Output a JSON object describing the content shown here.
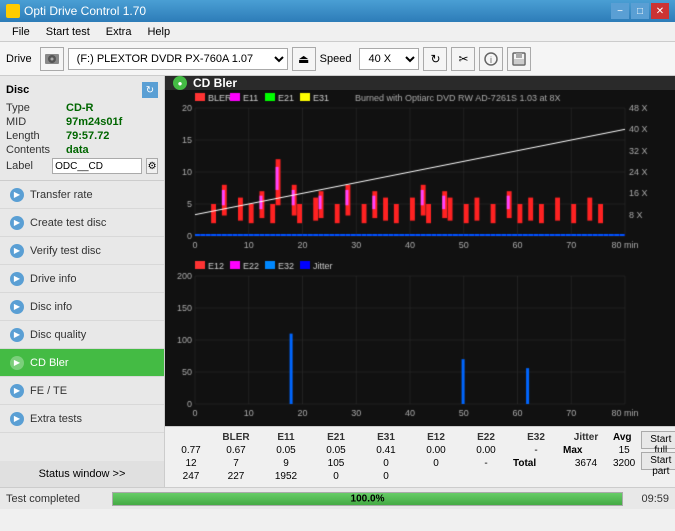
{
  "titleBar": {
    "title": "Opti Drive Control 1.70",
    "iconColor": "#ffcc00"
  },
  "menuBar": {
    "items": [
      "File",
      "Start test",
      "Extra",
      "Help"
    ]
  },
  "toolbar": {
    "driveLabel": "Drive",
    "driveValue": "(F:)  PLEXTOR DVDR  PX-760A 1.07",
    "speedLabel": "Speed",
    "speedValue": "40 X"
  },
  "discPanel": {
    "title": "Disc",
    "rows": [
      {
        "key": "Type",
        "value": "CD-R"
      },
      {
        "key": "MID",
        "value": "97m24s01f"
      },
      {
        "key": "Length",
        "value": "79:57.72"
      },
      {
        "key": "Contents",
        "value": "data"
      }
    ],
    "labelKey": "Label",
    "labelValue": "ODC__CD"
  },
  "navItems": [
    {
      "id": "transfer-rate",
      "label": "Transfer rate",
      "active": false
    },
    {
      "id": "create-test-disc",
      "label": "Create test disc",
      "active": false
    },
    {
      "id": "verify-test-disc",
      "label": "Verify test disc",
      "active": false
    },
    {
      "id": "drive-info",
      "label": "Drive info",
      "active": false
    },
    {
      "id": "disc-info",
      "label": "Disc info",
      "active": false
    },
    {
      "id": "disc-quality",
      "label": "Disc quality",
      "active": false
    },
    {
      "id": "cd-bler",
      "label": "CD Bler",
      "active": true
    },
    {
      "id": "fe-te",
      "label": "FE / TE",
      "active": false
    },
    {
      "id": "extra-tests",
      "label": "Extra tests",
      "active": false
    }
  ],
  "statusBtn": "Status window >>",
  "chart": {
    "title": "CD Bler",
    "legend1": [
      "BLER",
      "E11",
      "E21",
      "E31"
    ],
    "legend1Colors": [
      "#ff4444",
      "#ff00ff",
      "#00ff00",
      "#ffff00"
    ],
    "burnedWith": "Burned with Optiarc DVD RW AD-7261S 1.03 at 8X",
    "legend2": [
      "E12",
      "E22",
      "E32",
      "Jitter"
    ],
    "legend2Colors": [
      "#ff4444",
      "#ff00ff",
      "#0088ff",
      "#0000ff"
    ],
    "xLabels": [
      "0",
      "10",
      "20",
      "30",
      "40",
      "50",
      "60",
      "70",
      "80 min"
    ],
    "yLabels1": [
      "0",
      "5",
      "10",
      "15",
      "20"
    ],
    "yLabelsRight1": [
      "8 X",
      "16 X",
      "24 X",
      "32 X",
      "40 X",
      "48 X"
    ],
    "yLabels2": [
      "0",
      "50",
      "100",
      "150",
      "200"
    ],
    "statsColumns": [
      "BLER",
      "E11",
      "E21",
      "E31",
      "E12",
      "E22",
      "E32",
      "Jitter"
    ],
    "statsRows": [
      {
        "label": "Avg",
        "values": [
          "0.77",
          "0.67",
          "0.05",
          "0.05",
          "0.41",
          "0.00",
          "0.00",
          "-"
        ]
      },
      {
        "label": "Max",
        "values": [
          "15",
          "12",
          "7",
          "9",
          "105",
          "0",
          "0",
          "-"
        ]
      },
      {
        "label": "Total",
        "values": [
          "3674",
          "3200",
          "247",
          "227",
          "1952",
          "0",
          "0",
          ""
        ]
      }
    ],
    "startFullBtn": "Start full",
    "startPartBtn": "Start part"
  },
  "statusBar": {
    "text": "Test completed",
    "progress": 100,
    "progressText": "100.0%",
    "time": "09:59"
  }
}
